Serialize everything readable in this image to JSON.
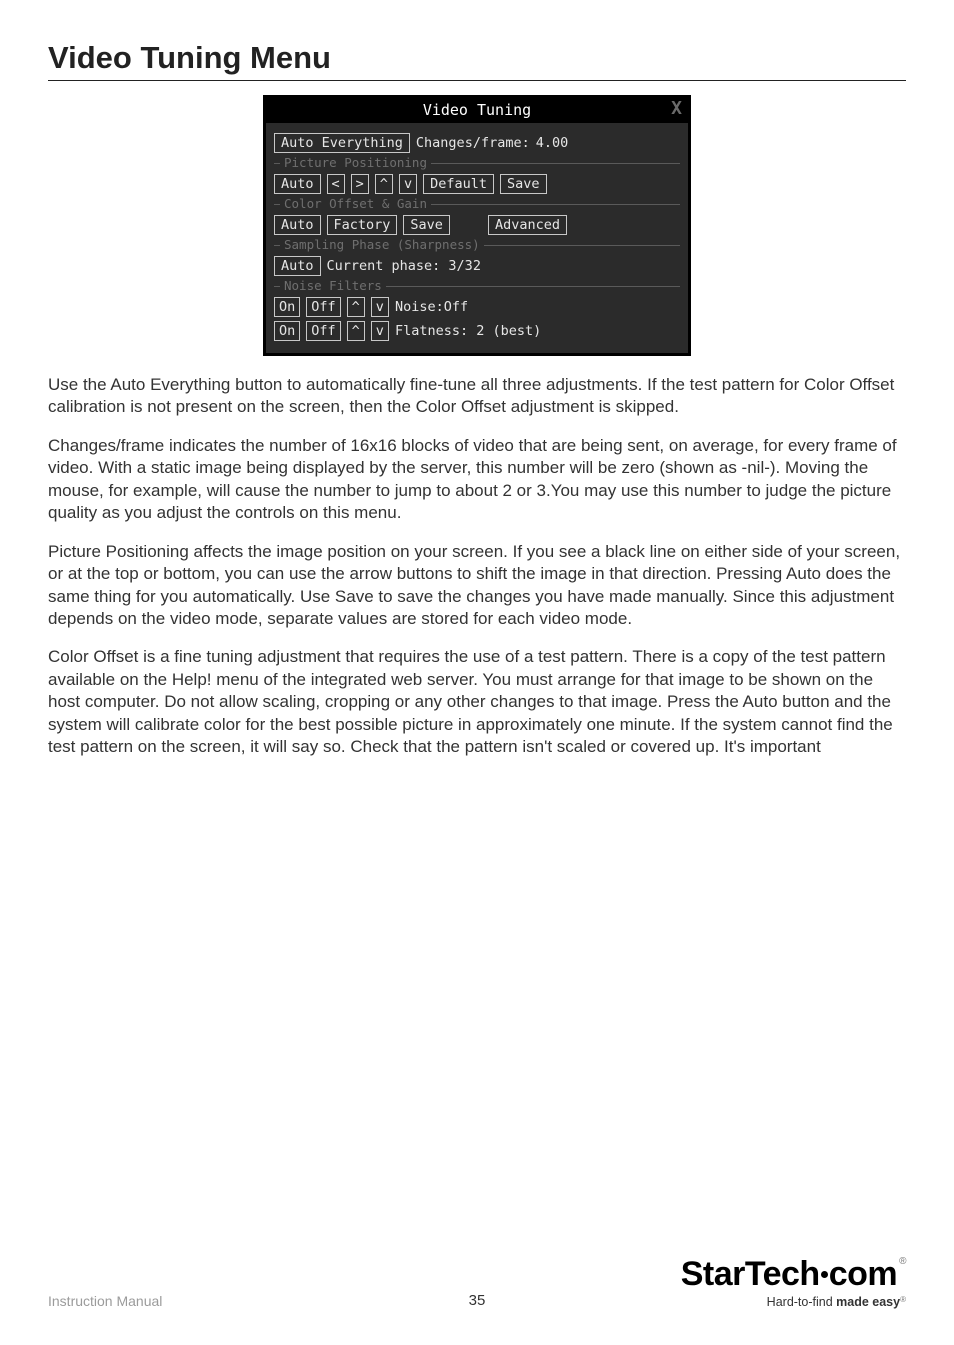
{
  "heading": "Video Tuning Menu",
  "panel": {
    "title": "Video Tuning",
    "close_glyph": "X",
    "row_top": {
      "auto_everything": "Auto Everything",
      "changes_label": "Changes/frame:",
      "changes_value": "4.00"
    },
    "picture_positioning": {
      "legend": "Picture Positioning",
      "auto": "Auto",
      "left": "<",
      "right": ">",
      "up": "^",
      "down": "v",
      "default": "Default",
      "save": "Save"
    },
    "color_offset": {
      "legend": "Color Offset & Gain",
      "auto": "Auto",
      "factory": "Factory",
      "save": "Save",
      "advanced": "Advanced"
    },
    "sampling": {
      "legend": "Sampling Phase (Sharpness)",
      "auto": "Auto",
      "phase_label": "Current phase: 3/32"
    },
    "noise": {
      "legend": "Noise Filters",
      "row1": {
        "on": "On",
        "off": "Off",
        "up": "^",
        "down": "v",
        "label": "Noise:Off"
      },
      "row2": {
        "on": "On",
        "off": "Off",
        "up": "^",
        "down": "v",
        "label": "Flatness: 2 (best)"
      }
    }
  },
  "paragraphs": {
    "p1": "Use the Auto Everything button to automatically fine-tune all three adjustments. If the test pattern for Color Offset calibration is not present on the screen, then the Color Offset adjustment is skipped.",
    "p2": "Changes/frame indicates the number of 16x16 blocks of video that are being sent, on average, for every frame of video. With a static image being displayed by the server, this number will be zero (shown as -nil-). Moving the mouse, for example, will cause the number to jump to about 2 or 3.You may use this number to judge the picture quality as you adjust the controls on this menu.",
    "p3": "Picture Positioning affects the image position on your screen. If you see a black line on either side of your screen, or at the top or bottom, you can use the arrow buttons to shift the image in that direction. Pressing Auto does the same thing for you automatically. Use Save to save the changes you have made manually. Since this adjustment depends on the video mode, separate values are stored for each video mode.",
    "p4": "Color Offset is a fine tuning adjustment that requires the use of a test pattern. There is a copy of the test pattern available on the Help! menu of the integrated web server. You must arrange for that image to be shown on the host computer. Do not allow scaling, cropping or any other changes to that image. Press the Auto button and the system will calibrate color for the best possible picture in approximately one minute. If the system cannot find the test pattern on the screen, it will say so. Check that the pattern isn't scaled or covered up. It's important"
  },
  "footer": {
    "manual": "Instruction Manual",
    "page": "35",
    "logo_text_1": "StarTech",
    "logo_text_2": "com",
    "tagline_1": "Hard-to-find ",
    "tagline_2": "made easy"
  }
}
